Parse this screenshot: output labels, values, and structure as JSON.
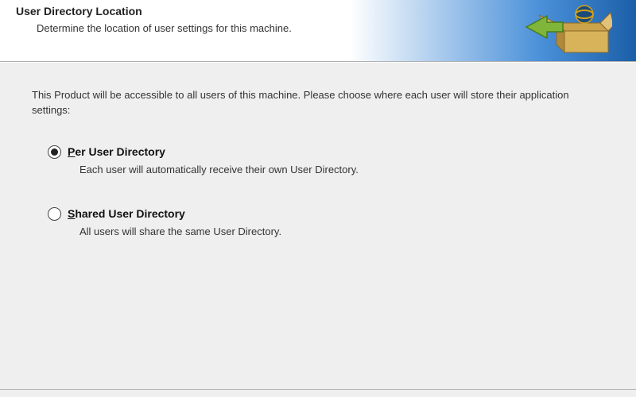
{
  "header": {
    "title": "User Directory Location",
    "subtitle": "Determine the location of user settings for this machine."
  },
  "main": {
    "intro": "This Product will be accessible to all users of this machine.  Please choose where each user will store their application settings:",
    "options": [
      {
        "label_before_underline": "",
        "underline_char": "P",
        "label_after_underline": "er User Directory",
        "description": "Each user will automatically receive their own User Directory.",
        "selected": true
      },
      {
        "label_before_underline": "",
        "underline_char": "S",
        "label_after_underline": "hared User Directory",
        "description": "All users will share the same User Directory.",
        "selected": false
      }
    ]
  }
}
